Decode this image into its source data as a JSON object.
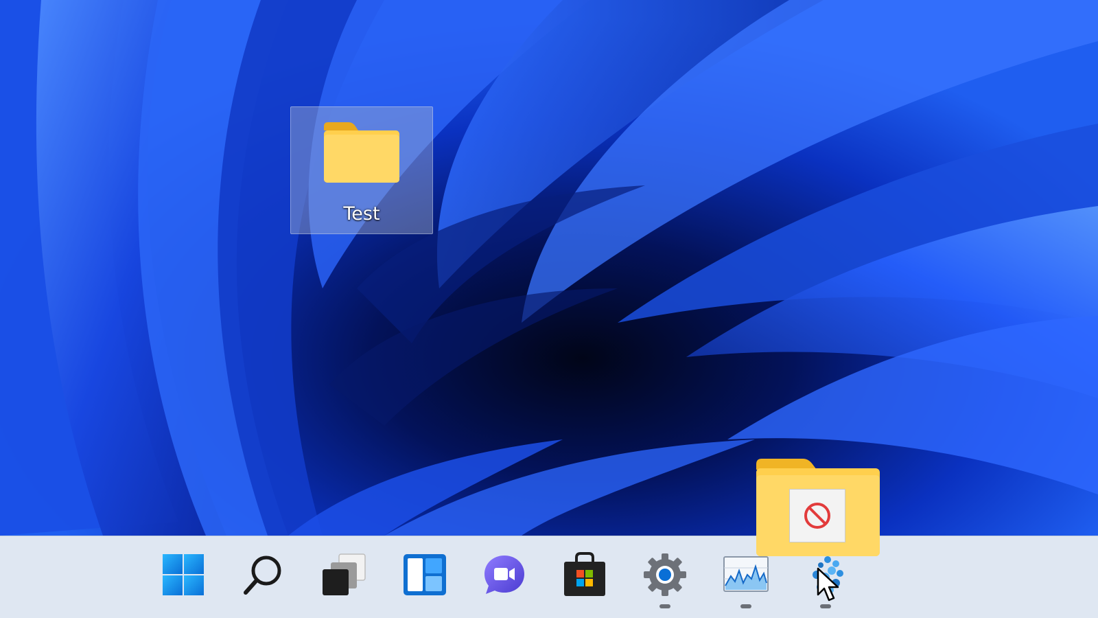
{
  "desktop": {
    "icons": [
      {
        "label": "Test",
        "icon": "folder-icon",
        "selected": true
      }
    ]
  },
  "drag": {
    "item_icon": "folder-icon",
    "status_icon": "no-drop-icon"
  },
  "taskbar": {
    "background": "#dfe7f2",
    "buttons": [
      {
        "name": "start",
        "icon": "windows-logo-icon",
        "running": false
      },
      {
        "name": "search",
        "icon": "search-icon",
        "running": false
      },
      {
        "name": "task-view",
        "icon": "task-view-icon",
        "running": false
      },
      {
        "name": "widgets",
        "icon": "widgets-icon",
        "running": false
      },
      {
        "name": "chat",
        "icon": "chat-video-icon",
        "running": false
      },
      {
        "name": "microsoft-store",
        "icon": "store-bag-icon",
        "running": false
      },
      {
        "name": "settings",
        "icon": "gear-icon",
        "running": true
      },
      {
        "name": "performance-monitor",
        "icon": "activity-graph-icon",
        "running": true
      },
      {
        "name": "drag-drop-app",
        "icon": "app-icon",
        "running": true
      }
    ]
  },
  "colors": {
    "wallpaper_base": "#0b2fb8",
    "folder_yellow": "#ffd35c",
    "accent_blue": "#0a6fd6",
    "no_drop_red": "#e23b3b"
  }
}
